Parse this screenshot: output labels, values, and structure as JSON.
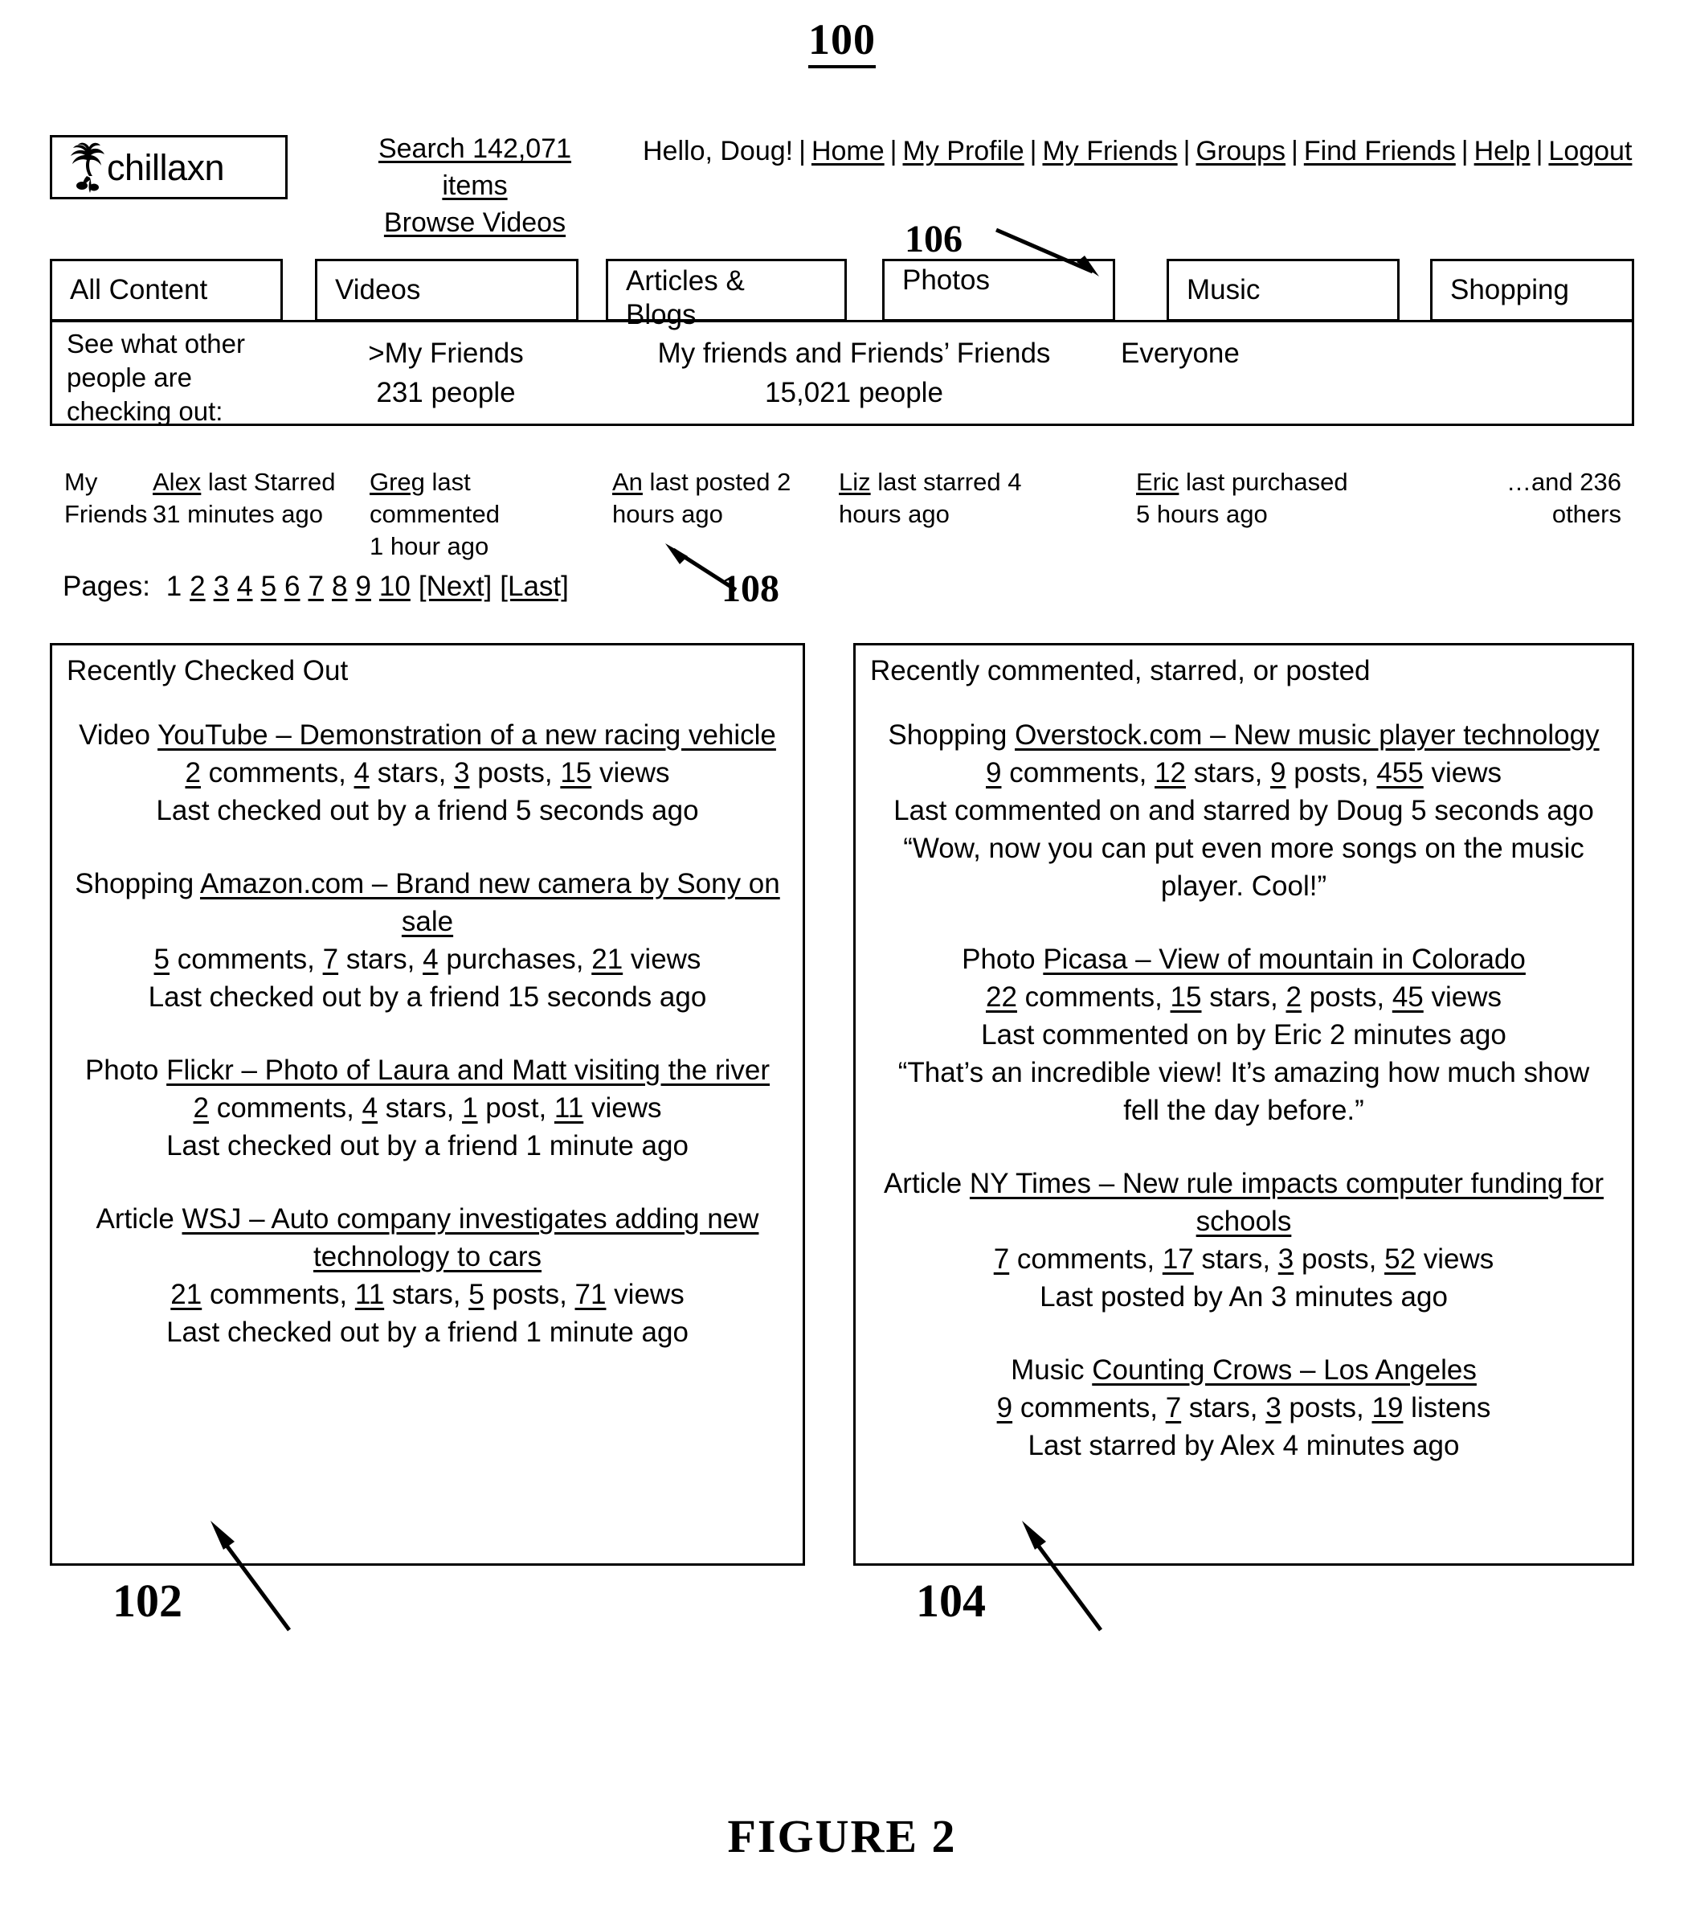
{
  "figure": {
    "top_number": "100",
    "caption": "FIGURE 2",
    "callouts": {
      "photos_tab": "106",
      "activity_item": "108",
      "left_panel": "102",
      "right_panel": "104"
    }
  },
  "header": {
    "logo_text": "chillaxn",
    "logo_icon": "palm-tree-icon",
    "search_line1": "Search 142,071 items",
    "search_line2": "Browse Videos",
    "greeting": "Hello, Doug!",
    "nav_links": [
      "Home",
      "My Profile",
      "My Friends",
      "Groups",
      "Find Friends",
      "Help",
      "Logout"
    ],
    "separator": "|"
  },
  "tabs": [
    {
      "label": "All Content",
      "two_line": false
    },
    {
      "label": "Videos",
      "two_line": false
    },
    {
      "label": "Articles & Blogs",
      "line1": "Articles &",
      "line2": "Blogs",
      "two_line": true
    },
    {
      "label": "Photos",
      "two_line": false
    },
    {
      "label": "Music",
      "two_line": false
    },
    {
      "label": "Shopping",
      "two_line": false
    }
  ],
  "filter_bar": {
    "label": "See what other people are checking out:",
    "options": [
      {
        "name": ">My Friends",
        "count": "231 people"
      },
      {
        "name": "My friends and Friends’ Friends",
        "count": "15,021 people"
      },
      {
        "name": "Everyone",
        "count": ""
      }
    ]
  },
  "activity": {
    "label_line1": "My",
    "label_line2": "Friends",
    "items": [
      {
        "user": "Alex",
        "text": " last Starred",
        "line2": "31 minutes ago"
      },
      {
        "user": "Greg",
        "text": " last commented",
        "line2": "1 hour ago"
      },
      {
        "user": "An",
        "text": " last posted 2",
        "line2": "hours ago"
      },
      {
        "user": "Liz",
        "text": " last starred 4",
        "line2": "hours ago"
      },
      {
        "user": "Eric",
        "text": " last purchased",
        "line2": "5 hours ago"
      }
    ],
    "more_line1": "…and 236",
    "more_line2": "others"
  },
  "pagination": {
    "label": "Pages:",
    "current": "1",
    "pages": [
      "2",
      "3",
      "4",
      "5",
      "6",
      "7",
      "8",
      "9",
      "10"
    ],
    "next": "[Next]",
    "last": "[Last]"
  },
  "left_panel": {
    "title": "Recently Checked Out",
    "entries": [
      {
        "kind": "Video ",
        "title": "YouTube – Demonstration of a new racing vehicle",
        "stats": [
          {
            "n": "2",
            "w": " comments, "
          },
          {
            "n": "4",
            "w": " stars, "
          },
          {
            "n": "3",
            "w": " posts, "
          },
          {
            "n": "15",
            "w": " views"
          }
        ],
        "meta": "Last checked out by a friend 5 seconds ago",
        "quote": ""
      },
      {
        "kind": "Shopping ",
        "title": "Amazon.com – Brand new camera by Sony on sale",
        "stats": [
          {
            "n": "5",
            "w": " comments, "
          },
          {
            "n": "7",
            "w": " stars, "
          },
          {
            "n": "4",
            "w": " purchases, "
          },
          {
            "n": "21",
            "w": " views"
          }
        ],
        "meta": "Last checked out by a friend 15 seconds ago",
        "quote": ""
      },
      {
        "kind": "Photo ",
        "title": "Flickr – Photo of Laura and Matt visiting the river",
        "stats": [
          {
            "n": "2",
            "w": " comments, "
          },
          {
            "n": "4",
            "w": " stars, "
          },
          {
            "n": "1",
            "w": " post, "
          },
          {
            "n": "11",
            "w": " views"
          }
        ],
        "meta": "Last checked out by a friend 1 minute ago",
        "quote": ""
      },
      {
        "kind": "Article ",
        "title": "WSJ – Auto company investigates adding new technology to cars",
        "stats": [
          {
            "n": "21",
            "w": " comments, "
          },
          {
            "n": "11",
            "w": " stars, "
          },
          {
            "n": "5",
            "w": " posts, "
          },
          {
            "n": "71",
            "w": " views"
          }
        ],
        "meta": "Last checked out by a friend 1 minute ago",
        "quote": ""
      }
    ]
  },
  "right_panel": {
    "title": "Recently commented, starred, or posted",
    "entries": [
      {
        "kind": "Shopping ",
        "title": "Overstock.com – New music player technology",
        "stats": [
          {
            "n": "9",
            "w": " comments, "
          },
          {
            "n": "12",
            "w": " stars, "
          },
          {
            "n": "9",
            "w": " posts, "
          },
          {
            "n": "455",
            "w": " views"
          }
        ],
        "meta": "Last commented on and starred by Doug 5 seconds ago",
        "quote": "“Wow, now you can put even more songs on the music player. Cool!”"
      },
      {
        "kind": "Photo ",
        "title": "Picasa – View of mountain in Colorado",
        "stats": [
          {
            "n": "22",
            "w": " comments, "
          },
          {
            "n": "15",
            "w": " stars, "
          },
          {
            "n": "2",
            "w": " posts, "
          },
          {
            "n": "45",
            "w": " views"
          }
        ],
        "meta": "Last commented on by Eric 2 minutes ago",
        "quote": "“That’s an incredible view! It’s amazing how much show fell the day before.”"
      },
      {
        "kind": "Article ",
        "title": "NY Times – New rule impacts computer funding for schools",
        "stats": [
          {
            "n": "7",
            "w": " comments, "
          },
          {
            "n": "17",
            "w": " stars, "
          },
          {
            "n": "3",
            "w": " posts, "
          },
          {
            "n": "52",
            "w": " views"
          }
        ],
        "meta": "Last posted by An 3 minutes ago",
        "quote": ""
      },
      {
        "kind": "Music ",
        "title": "Counting Crows – Los Angeles",
        "stats": [
          {
            "n": "9",
            "w": " comments, "
          },
          {
            "n": "7",
            "w": " stars, "
          },
          {
            "n": "3",
            "w": " posts, "
          },
          {
            "n": "19",
            "w": " listens"
          }
        ],
        "meta": "Last starred by Alex 4 minutes ago",
        "quote": ""
      }
    ]
  }
}
